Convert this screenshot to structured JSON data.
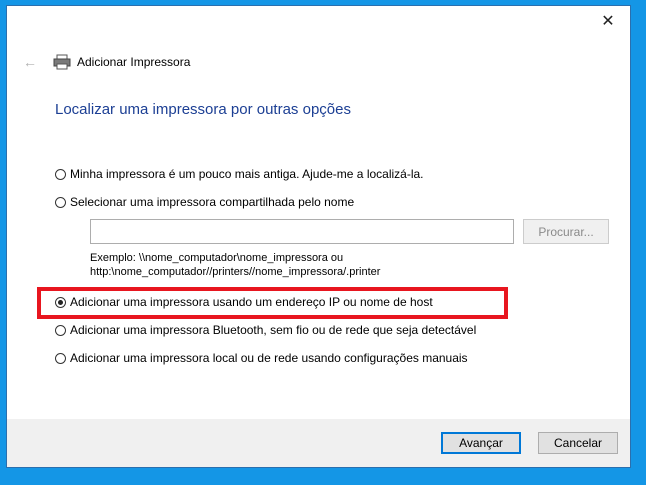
{
  "window": {
    "title": "Adicionar Impressora",
    "close_glyph": "✕",
    "back_glyph": "←"
  },
  "page_title": "Localizar uma impressora por outras opções",
  "options": [
    {
      "label": "Minha impressora é um pouco mais antiga. Ajude-me a localizá-la.",
      "checked": false
    },
    {
      "label": "Selecionar uma impressora compartilhada pelo nome",
      "checked": false
    },
    {
      "label": "Adicionar uma impressora usando um endereço IP ou nome de host",
      "checked": true
    },
    {
      "label": "Adicionar uma impressora Bluetooth, sem fio ou de rede que seja detectável",
      "checked": false
    },
    {
      "label": "Adicionar uma impressora local ou de rede usando configurações manuais",
      "checked": false
    }
  ],
  "shared_name": {
    "value": "",
    "browse_label": "Procurar...",
    "example_line1": "Exemplo: \\\\nome_computador\\nome_impressora ou",
    "example_line2": "http:\\nome_computador//printers//nome_impressora/.printer"
  },
  "footer": {
    "next_label": "Avançar",
    "cancel_label": "Cancelar"
  },
  "colors": {
    "title_blue": "#1c3f94",
    "highlight_red": "#e8161f",
    "desktop_blue": "#1496e6"
  }
}
